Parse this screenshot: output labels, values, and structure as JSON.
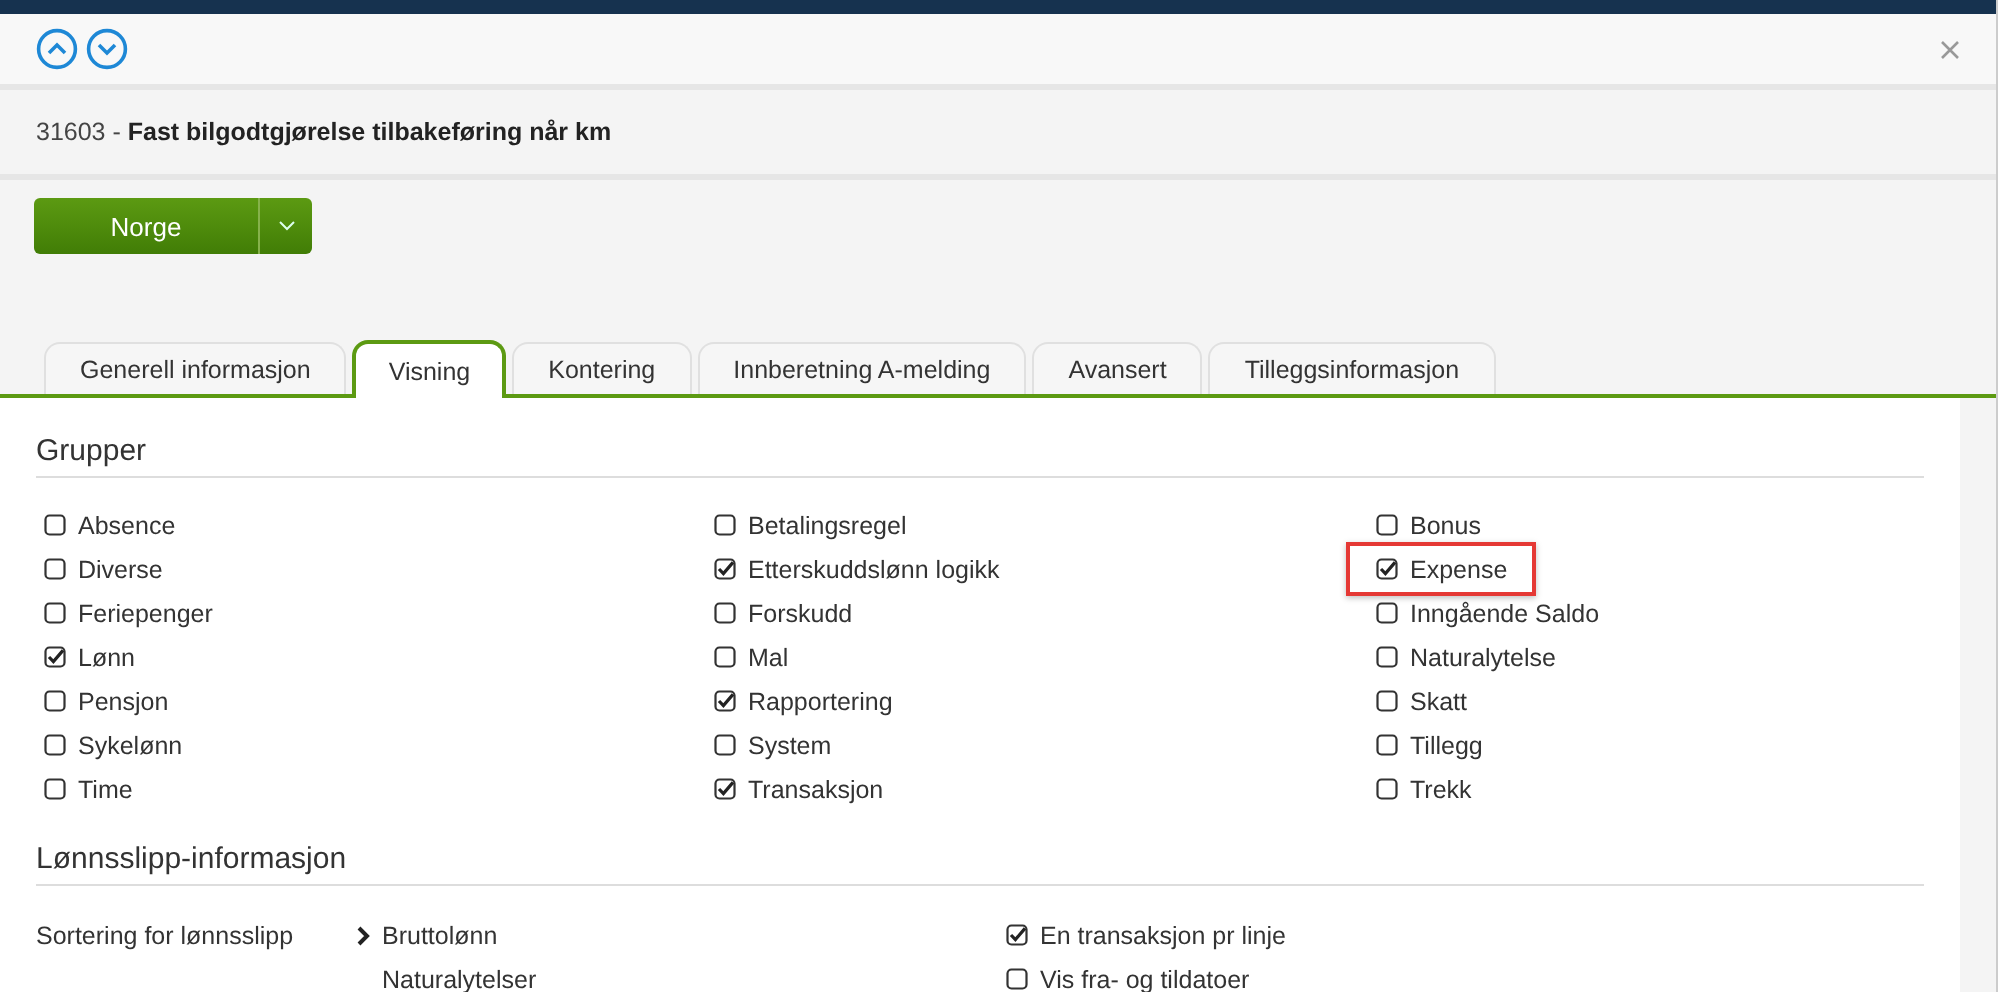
{
  "title": "31603 - **Fast bilgodtgjørelse tilbakeføring når km**",
  "country_button": {
    "label": "Norge"
  },
  "tabs": [
    {
      "label": "Generell informasjon",
      "selected": false
    },
    {
      "label": "Visning",
      "selected": true
    },
    {
      "label": "Kontering",
      "selected": false
    },
    {
      "label": "Innberetning A-melding",
      "selected": false
    },
    {
      "label": "Avansert",
      "selected": false
    },
    {
      "label": "Tilleggsinformasjon",
      "selected": false
    }
  ],
  "groups": {
    "heading": "Grupper",
    "columns": [
      [
        {
          "label": "Absence",
          "checked": false,
          "highlighted": false
        },
        {
          "label": "Diverse",
          "checked": false,
          "highlighted": false
        },
        {
          "label": "Feriepenger",
          "checked": false,
          "highlighted": false
        },
        {
          "label": "Lønn",
          "checked": true,
          "highlighted": false
        },
        {
          "label": "Pensjon",
          "checked": false,
          "highlighted": false
        },
        {
          "label": "Sykelønn",
          "checked": false,
          "highlighted": false
        },
        {
          "label": "Time",
          "checked": false,
          "highlighted": false
        }
      ],
      [
        {
          "label": "Betalingsregel",
          "checked": false,
          "highlighted": false
        },
        {
          "label": "Etterskuddslønn logikk",
          "checked": true,
          "highlighted": false
        },
        {
          "label": "Forskudd",
          "checked": false,
          "highlighted": false
        },
        {
          "label": "Mal",
          "checked": false,
          "highlighted": false
        },
        {
          "label": "Rapportering",
          "checked": true,
          "highlighted": false
        },
        {
          "label": "System",
          "checked": false,
          "highlighted": false
        },
        {
          "label": "Transaksjon",
          "checked": true,
          "highlighted": false
        }
      ],
      [
        {
          "label": "Bonus",
          "checked": false,
          "highlighted": false
        },
        {
          "label": "Expense",
          "checked": true,
          "highlighted": true
        },
        {
          "label": "Inngående Saldo",
          "checked": false,
          "highlighted": false
        },
        {
          "label": "Naturalytelse",
          "checked": false,
          "highlighted": false
        },
        {
          "label": "Skatt",
          "checked": false,
          "highlighted": false
        },
        {
          "label": "Tillegg",
          "checked": false,
          "highlighted": false
        },
        {
          "label": "Trekk",
          "checked": false,
          "highlighted": false
        }
      ]
    ]
  },
  "payslip": {
    "heading": "Lønnsslipp-informasjon",
    "sort_label": "Sortering for lønnsslipp",
    "sort_options": [
      {
        "label": "Bruttolønn",
        "selected": true
      },
      {
        "label": "Naturalytelser",
        "selected": false
      }
    ],
    "options": [
      {
        "label": "En transaksjon pr linje",
        "checked": true
      },
      {
        "label": "Vis fra- og tildatoer",
        "checked": false
      }
    ]
  }
}
